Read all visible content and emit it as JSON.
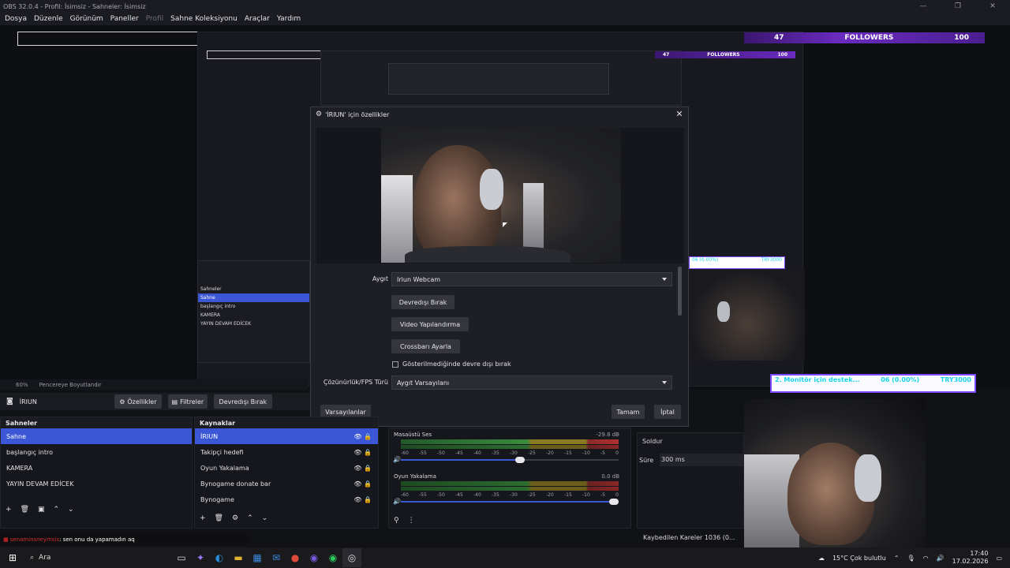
{
  "window": {
    "title": "OBS 32.0.4 - Profil: İsimsiz - Sahneler: İsimsiz",
    "buttons": [
      "—",
      "❐",
      "✕"
    ]
  },
  "menu": [
    "Dosya",
    "Düzenle",
    "Görünüm",
    "Paneller",
    "Profil",
    "Sahne Koleksiyonu",
    "Araçlar",
    "Yardım"
  ],
  "overlay": {
    "followers_count": "47",
    "followers_label": "FOLLOWERS",
    "followers_goal": "100",
    "donate_left": "2. Monitör için destek...",
    "donate_mid": "06 (0.00%)",
    "donate_right": "TRY3000"
  },
  "dialog": {
    "title": "'İRIUN' için özellikler",
    "device_label": "Aygıt",
    "device_value": "Iriun Webcam",
    "btn_deactivate": "Devredışı Bırak",
    "btn_video_config": "Video Yapılandırma",
    "btn_crossbar": "Crossbarı Ayarla",
    "chk_label": "Gösterilmediğinde devre dışı bırak",
    "res_label": "Çözünürlük/FPS Türü",
    "res_value": "Aygıt Varsayılanı",
    "btn_defaults": "Varsayılanlar",
    "btn_ok": "Tamam",
    "btn_cancel": "İptal"
  },
  "statusline": {
    "zoom": "60%",
    "fit": "Pencereye Boyutlandır"
  },
  "sourcebar": {
    "source_name": "İRIUN",
    "btn_properties": "Özellikler",
    "btn_filters": "Filtreler",
    "btn_deactivate": "Devredışı Bırak"
  },
  "scenes": {
    "title": "Sahneler",
    "items": [
      "Sahne",
      "başlangıç intro",
      "KAMERA",
      "YAYIN DEVAM EDİCEK"
    ]
  },
  "sources": {
    "title": "Kaynaklar",
    "items": [
      "İRIUN",
      "Takipçi hedefi",
      "Oyun Yakalama",
      "Bynogame donate bar",
      "Bynogame"
    ]
  },
  "mixer": {
    "tracks": [
      {
        "name": "Masaüstü Ses",
        "db": "-29.8 dB",
        "volume_pct": 57
      },
      {
        "name": "Oyun Yakalama",
        "db": "0.0 dB",
        "volume_pct": 100
      }
    ],
    "ticks": [
      "-60",
      "-55",
      "-50",
      "-45",
      "-40",
      "-35",
      "-30",
      "-25",
      "-20",
      "-15",
      "-10",
      "-5",
      "0"
    ]
  },
  "transitions": {
    "type": "Soldur",
    "duration_label": "Süre",
    "duration_value": "300 ms"
  },
  "stats": {
    "dropped_frames": "Kaybedilen Kareler 1036 (0..."
  },
  "chat": {
    "user": "senaminsneymsis",
    "message": ": sen onu da yapamadın aq"
  },
  "taskbar": {
    "search": "Ara",
    "weather": "15°C Çok bulutlu",
    "time": "17:40",
    "date": "17.02.2026"
  }
}
